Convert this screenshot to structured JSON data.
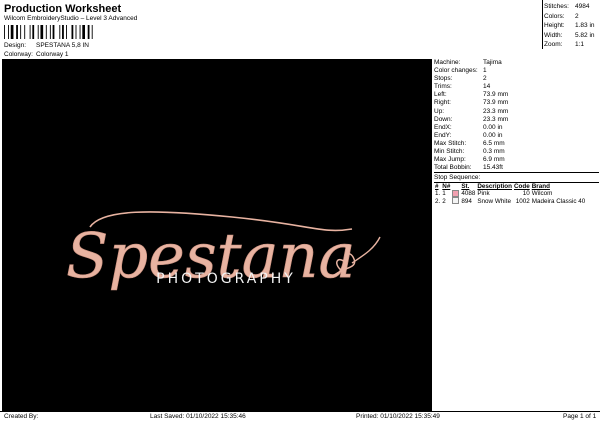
{
  "header": {
    "title": "Production Worksheet",
    "subtitle": "Wilcom EmbroideryStudio – Level 3 Advanced",
    "design_label": "Design:",
    "design_value": "SPESTANA 5,8 IN",
    "colorway_label": "Colorway:",
    "colorway_value": "Colorway 1"
  },
  "top_stats": [
    {
      "label": "Stitches:",
      "value": "4984"
    },
    {
      "label": "Colors:",
      "value": "2"
    },
    {
      "label": "Height:",
      "value": "1.83 in"
    },
    {
      "label": "Width:",
      "value": "5.82 in"
    },
    {
      "label": "Zoom:",
      "value": "1:1"
    }
  ],
  "design_preview": {
    "script_text": "Spestana",
    "tagline": "PHOTOGRAPHY",
    "thread_color": "#e8b3a1"
  },
  "machine_info": [
    {
      "label": "Machine:",
      "value": "Tajima"
    },
    {
      "label": "Color changes:",
      "value": "1"
    },
    {
      "label": "Stops:",
      "value": "2"
    },
    {
      "label": "Trims:",
      "value": "14"
    },
    {
      "label": "Left:",
      "value": "73.9 mm"
    },
    {
      "label": "Right:",
      "value": "73.9 mm"
    },
    {
      "label": "Up:",
      "value": "23.3 mm"
    },
    {
      "label": "Down:",
      "value": "23.3 mm"
    },
    {
      "label": "EndX:",
      "value": "0.00 in"
    },
    {
      "label": "EndY:",
      "value": "0.00 in"
    },
    {
      "label": "Max Stitch:",
      "value": "6.5 mm"
    },
    {
      "label": "Min Stitch:",
      "value": "0.3 mm"
    },
    {
      "label": "Max Jump:",
      "value": "6.9 mm"
    },
    {
      "label": "Total Bobbin:",
      "value": "15.43ft"
    }
  ],
  "stop_sequence": {
    "title": "Stop Sequence:",
    "headers": [
      "#",
      "N#",
      "St.",
      "Description",
      "Code",
      "Brand"
    ],
    "rows": [
      {
        "num": "1.",
        "n": "1",
        "color": "#f2a0b0",
        "st": "4088",
        "desc": "Pink",
        "code": "10",
        "brand": "Wilcom"
      },
      {
        "num": "2.",
        "n": "2",
        "color": "#f4f4f4",
        "st": "894",
        "desc": "Snow White",
        "code": "1002",
        "brand": "Madeira Classic 40"
      }
    ]
  },
  "footer": {
    "created": "Created By:",
    "saved": "Last Saved: 01/10/2022 15:35:46",
    "printed": "Printed: 01/10/2022 15:35:49",
    "page": "Page 1 of 1"
  }
}
